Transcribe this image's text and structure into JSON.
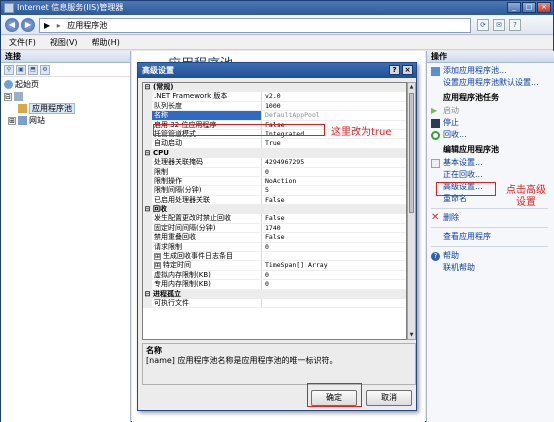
{
  "window": {
    "title": "Internet 信息服务(IIS)管理器",
    "minimize": "_",
    "maximize": "□",
    "close": "×"
  },
  "address": {
    "arrow": "▶",
    "crumb": "应用程序池",
    "back": "◀",
    "forward": "▶",
    "tb1": "⟳",
    "tb2": "✉",
    "tb3": "?"
  },
  "menu": [
    "文件(F)",
    "视图(V)",
    "帮助(H)"
  ],
  "connections": {
    "header": "连接",
    "tools": [
      "⚲",
      "▣",
      "⬒",
      "⚙"
    ],
    "tree": [
      {
        "label": "起始页",
        "expander": "",
        "indent": 0
      },
      {
        "label": "",
        "expander": "⊟",
        "indent": 0
      },
      {
        "label": "应用程序池",
        "expander": "",
        "indent": 1,
        "selected": true
      },
      {
        "label": "网站",
        "expander": "⊞",
        "indent": 1
      }
    ]
  },
  "center": {
    "heading": "应用程序池"
  },
  "actions": {
    "header": "操作",
    "items_top": [
      {
        "label": "添加应用程序池...",
        "disabled": false,
        "icon": "add-pool-icon"
      },
      {
        "label": "设置应用程序池默认设置...",
        "disabled": false,
        "icon": ""
      }
    ],
    "task_title": "应用程序池任务",
    "task_items": [
      {
        "label": "启动",
        "disabled": true,
        "icon": "play-icon"
      },
      {
        "label": "停止",
        "disabled": false,
        "icon": "stop-icon"
      },
      {
        "label": "回收...",
        "disabled": false,
        "icon": "recycle-icon"
      }
    ],
    "edit_title": "编辑应用程序池",
    "edit_items": [
      {
        "label": "基本设置...",
        "disabled": false,
        "icon": "settings-icon"
      },
      {
        "label": "正在回收...",
        "disabled": false,
        "icon": ""
      },
      {
        "label": "高级设置...",
        "disabled": false,
        "icon": ""
      },
      {
        "label": "重命名",
        "disabled": false,
        "icon": ""
      }
    ],
    "delete": "删除",
    "view_apps": "查看应用程序",
    "help": "帮助",
    "online_help": "联机帮助"
  },
  "dialog": {
    "title": "高级设置",
    "help_btn": "?",
    "close_btn": "×",
    "properties": [
      {
        "type": "cat",
        "toggle": "⊟",
        "name": "(常规)"
      },
      {
        "type": "row",
        "name": ".NET Framework 版本",
        "value": "v2.0"
      },
      {
        "type": "row",
        "name": "队列长度",
        "value": "1000"
      },
      {
        "type": "row",
        "name": "名称",
        "value": "DefaultAppPool",
        "selected": true,
        "dim": true
      },
      {
        "type": "row",
        "name": "启用 32 位应用程序",
        "value": "False"
      },
      {
        "type": "row",
        "name": "托管管道模式",
        "value": "Integrated"
      },
      {
        "type": "row",
        "name": "自动启动",
        "value": "True"
      },
      {
        "type": "cat",
        "toggle": "⊟",
        "name": "CPU"
      },
      {
        "type": "row",
        "name": "处理器关联掩码",
        "value": "4294967295"
      },
      {
        "type": "row",
        "name": "限制",
        "value": "0"
      },
      {
        "type": "row",
        "name": "限制操作",
        "value": "NoAction"
      },
      {
        "type": "row",
        "name": "限制间隔(分钟)",
        "value": "5"
      },
      {
        "type": "row",
        "name": "已启用处理器关联",
        "value": "False"
      },
      {
        "type": "cat",
        "toggle": "⊟",
        "name": "回收"
      },
      {
        "type": "row",
        "name": "发生配置更改时禁止回收",
        "value": "False"
      },
      {
        "type": "row",
        "name": "固定时间间隔(分钟)",
        "value": "1740"
      },
      {
        "type": "row",
        "name": "禁用重叠回收",
        "value": "False"
      },
      {
        "type": "row",
        "name": "请求限制",
        "value": "0"
      },
      {
        "type": "row",
        "name": "生成回收事件日志条目",
        "value": "",
        "sub": "⊞"
      },
      {
        "type": "row",
        "name": "特定时间",
        "value": "TimeSpan[] Array",
        "sub": "⊞"
      },
      {
        "type": "row",
        "name": "虚拟内存限制(KB)",
        "value": "0"
      },
      {
        "type": "row",
        "name": "专用内存限制(KB)",
        "value": "0"
      },
      {
        "type": "cat",
        "toggle": "⊟",
        "name": "进程孤立"
      },
      {
        "type": "row",
        "name": "可执行文件",
        "value": ""
      }
    ],
    "desc_title": "名称",
    "desc_text": "[name] 应用程序池名称是应用程序池的唯一标识符。",
    "ok": "确定",
    "cancel": "取消"
  },
  "annotations": {
    "note_32bit": "这里改为true",
    "note_advanced": "点击高级\n设置"
  }
}
